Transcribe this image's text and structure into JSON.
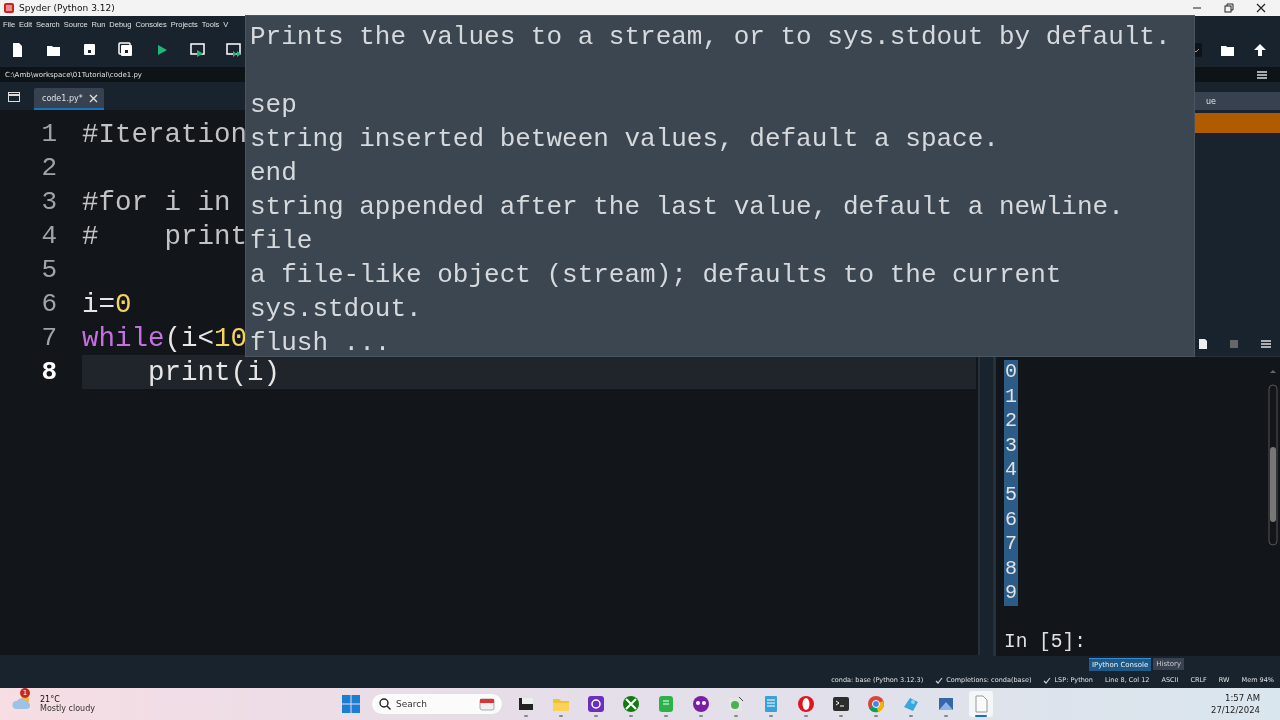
{
  "window": {
    "title": "Spyder (Python 3.12)"
  },
  "menu": [
    "File",
    "Edit",
    "Search",
    "Source",
    "Run",
    "Debug",
    "Consoles",
    "Projects",
    "Tools",
    "V"
  ],
  "toolbar": [
    {
      "kind": "new"
    },
    {
      "kind": "open"
    },
    {
      "kind": "save"
    },
    {
      "kind": "saveall"
    },
    {
      "kind": "run"
    },
    {
      "kind": "runcell"
    },
    {
      "kind": "runnext"
    }
  ],
  "toolbar_right": [
    {
      "kind": "dropdown"
    },
    {
      "kind": "open"
    },
    {
      "kind": "up"
    }
  ],
  "path": "C:\\Amb\\workspace\\01Tutorial\\code1.py",
  "editor": {
    "tabs": [
      {
        "label": "code1.py*",
        "selected": true
      }
    ],
    "lines": [
      {
        "number": "1",
        "current": false,
        "tokens": [
          {
            "text": "#Iteration",
            "kind": "comment"
          }
        ]
      },
      {
        "number": "2",
        "current": false
      },
      {
        "number": "3",
        "current": false,
        "tokens": [
          {
            "text": "#for i in",
            "kind": "comment"
          }
        ]
      },
      {
        "number": "4",
        "current": false,
        "tokens": [
          {
            "text": "#    print",
            "kind": "comment"
          }
        ]
      },
      {
        "number": "5",
        "current": false
      },
      {
        "number": "6",
        "current": false,
        "tokens": [
          {
            "text": "i=",
            "kind": "plain"
          },
          {
            "text": "0",
            "kind": "number"
          }
        ]
      },
      {
        "number": "7",
        "current": false,
        "tokens": [
          {
            "text": "while",
            "kind": "keyword"
          },
          {
            "text": "(i<",
            "kind": "plain"
          },
          {
            "text": "10",
            "kind": "number"
          }
        ]
      },
      {
        "number": "8",
        "current": true,
        "tokens": [
          {
            "text": "    print(i)",
            "kind": "plain"
          }
        ]
      }
    ]
  },
  "tooltip": {
    "summary": "Prints the values to a stream, or to sys.stdout by default.",
    "lines": [
      "sep",
      "string inserted between values, default a space.",
      "end",
      "string appended after the last value, default a newline.",
      "file",
      "a file-like object (stream); defaults to the current",
      "sys.stdout.",
      "flush ..."
    ]
  },
  "variable_explorer": {
    "column": "ue",
    "rows": [
      {
        "selected": true
      }
    ]
  },
  "console": {
    "output": [
      "0",
      "1",
      "2",
      "3",
      "4",
      "5",
      "6",
      "7",
      "8",
      "9"
    ],
    "output_selected": true,
    "prompt": "In [5]:"
  },
  "pane_tabs": [
    {
      "label": "IPython Console",
      "selected": true
    },
    {
      "label": "History",
      "selected": false
    }
  ],
  "status_bar": [
    {
      "text": "conda: base (Python 3.12.3)",
      "kind": "plain"
    },
    {
      "text": "Completions: conda(base)",
      "kind": "check"
    },
    {
      "text": "LSP: Python",
      "kind": "check"
    },
    {
      "text": "Line 8, Col 12",
      "kind": "plain"
    },
    {
      "text": "ASCII",
      "kind": "plain"
    },
    {
      "text": "CRLF",
      "kind": "plain"
    },
    {
      "text": "RW",
      "kind": "plain"
    },
    {
      "text": "Mem 94%",
      "kind": "plain"
    }
  ],
  "taskbar": {
    "weather": {
      "badge": "1",
      "temperature": "21°C",
      "condition": "Mostly cloudy"
    },
    "search": {
      "placeholder": "Search"
    },
    "apps": [
      {
        "kind": "terminal-light",
        "selected": false
      },
      {
        "kind": "folder",
        "selected": false
      },
      {
        "kind": "purple",
        "selected": false
      },
      {
        "kind": "xbox",
        "selected": false
      },
      {
        "kind": "green",
        "selected": false
      },
      {
        "kind": "mask",
        "selected": false
      },
      {
        "kind": "snake",
        "selected": false
      },
      {
        "kind": "notepad",
        "selected": false
      },
      {
        "kind": "opera",
        "selected": false
      },
      {
        "kind": "terminal",
        "selected": false
      },
      {
        "kind": "chrome",
        "selected": false
      },
      {
        "kind": "bird",
        "selected": false
      },
      {
        "kind": "blue",
        "selected": false
      },
      {
        "kind": "file",
        "selected": true
      }
    ],
    "time": "1:57 AM",
    "date": "27/12/2024"
  }
}
